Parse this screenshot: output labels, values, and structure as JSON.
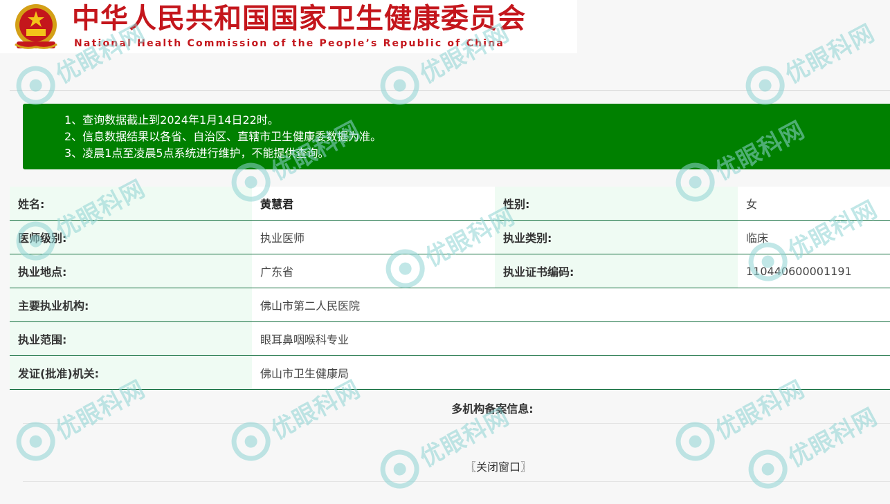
{
  "header": {
    "title_cn": "中华人民共和国国家卫生健康委员会",
    "title_en": "National Health Commission of the People’s Republic of China",
    "emblem_icon": "national-emblem-icon"
  },
  "notice": {
    "bg_color": "#008000",
    "lines": [
      "1、查询数据截止到2024年1月14日22时。",
      "2、信息数据结果以各省、自治区、直辖市卫生健康委数据为准。",
      "3、凌晨1点至凌晨5点系统进行维护，不能提供查询。"
    ]
  },
  "info": {
    "name_label": "姓名:",
    "name_value": "黄慧君",
    "gender_label": "性别:",
    "gender_value": "女",
    "level_label": "医师级别:",
    "level_value": "执业医师",
    "category_label": "执业类别:",
    "category_value": "临床",
    "location_label": "执业地点:",
    "location_value": "广东省",
    "cert_label": "执业证书编码:",
    "cert_value": "110440600001191",
    "org_label": "主要执业机构:",
    "org_value": "佛山市第二人民医院",
    "scope_label": "执业范围:",
    "scope_value": "眼耳鼻咽喉科专业",
    "issuer_label": "发证(批准)机关:",
    "issuer_value": "佛山市卫生健康局"
  },
  "multi": {
    "title": "多机构备案信息:"
  },
  "close_label": "〖关闭窗口〗",
  "watermark": {
    "text": "优眼科网",
    "color": "#8fd4d4"
  },
  "colors": {
    "brand_red": "#c4161c",
    "label_bg": "#effbf3",
    "row_border": "#0e6b3a"
  }
}
